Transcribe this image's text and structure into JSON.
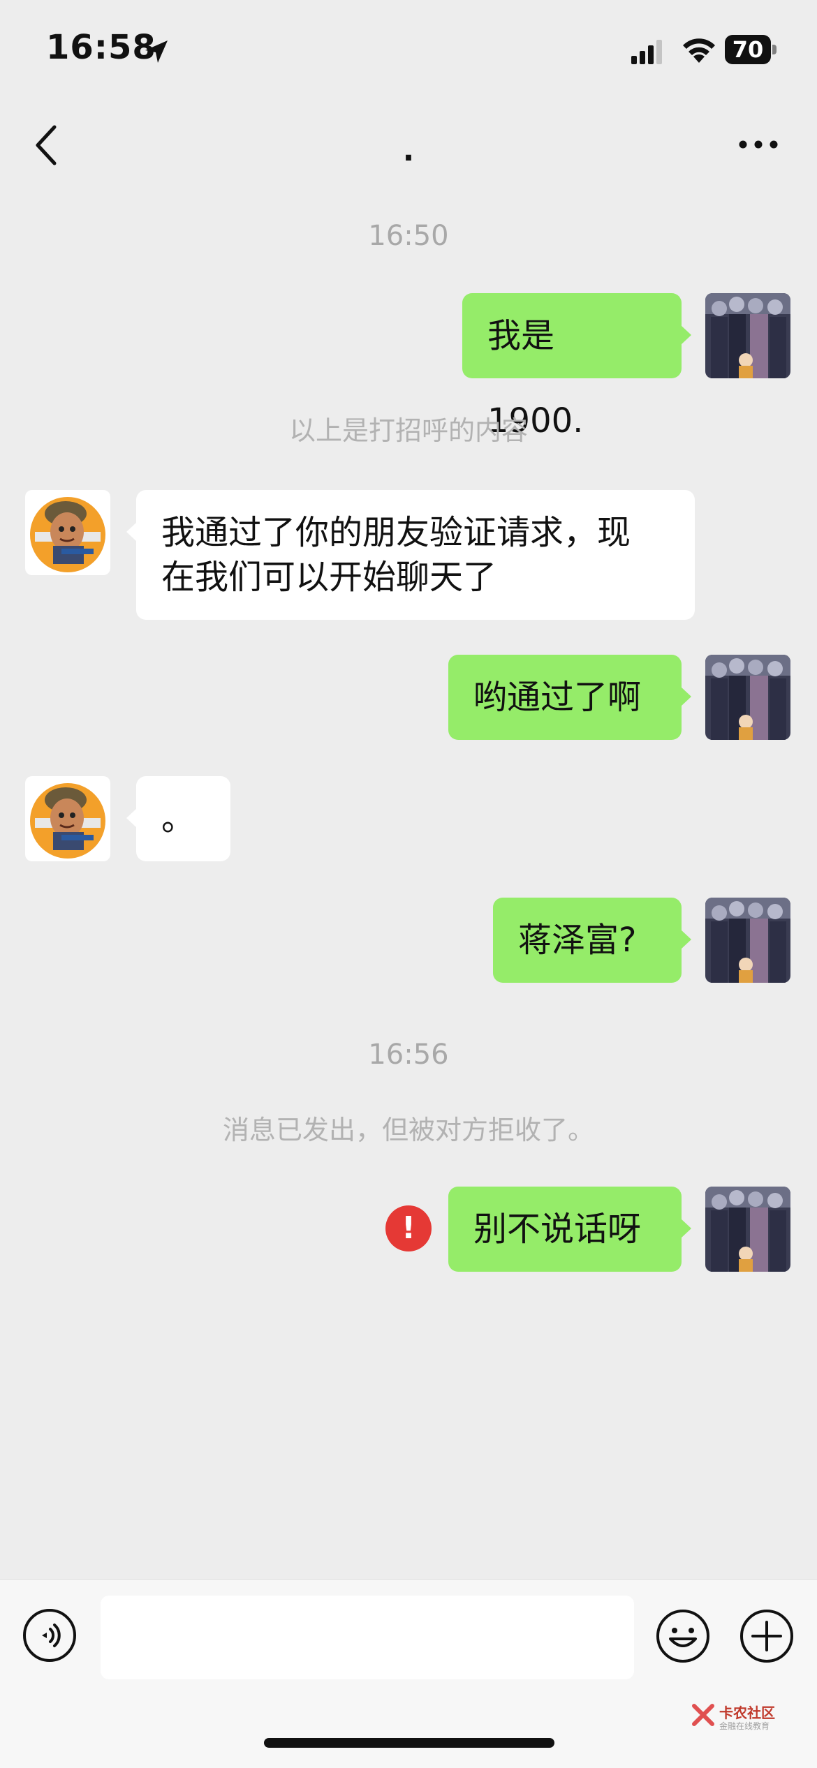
{
  "status_bar": {
    "time": "16:58",
    "battery": "70"
  },
  "header": {
    "title": "."
  },
  "messages": {
    "timestamp_1": "16:50",
    "m1": "我是 1900.",
    "greeting_note": "以上是打招呼的内容",
    "m2_line1": "我通过了你的朋友验证请求，现",
    "m2_line2": "在我们可以开始聊天了",
    "m3": "哟通过了啊",
    "m4": "。",
    "m5": "蒋泽富?",
    "timestamp_2": "16:56",
    "rejected_note": "消息已发出，但被对方拒收了。",
    "m6": "别不说话呀"
  },
  "error_icon": "!",
  "watermark": {
    "text": "卡农社区",
    "sub": "金融在线教育"
  },
  "colors": {
    "my_bubble": "#95ec69",
    "their_bubble": "#ffffff",
    "background": "#ededed",
    "error": "#e53935"
  }
}
